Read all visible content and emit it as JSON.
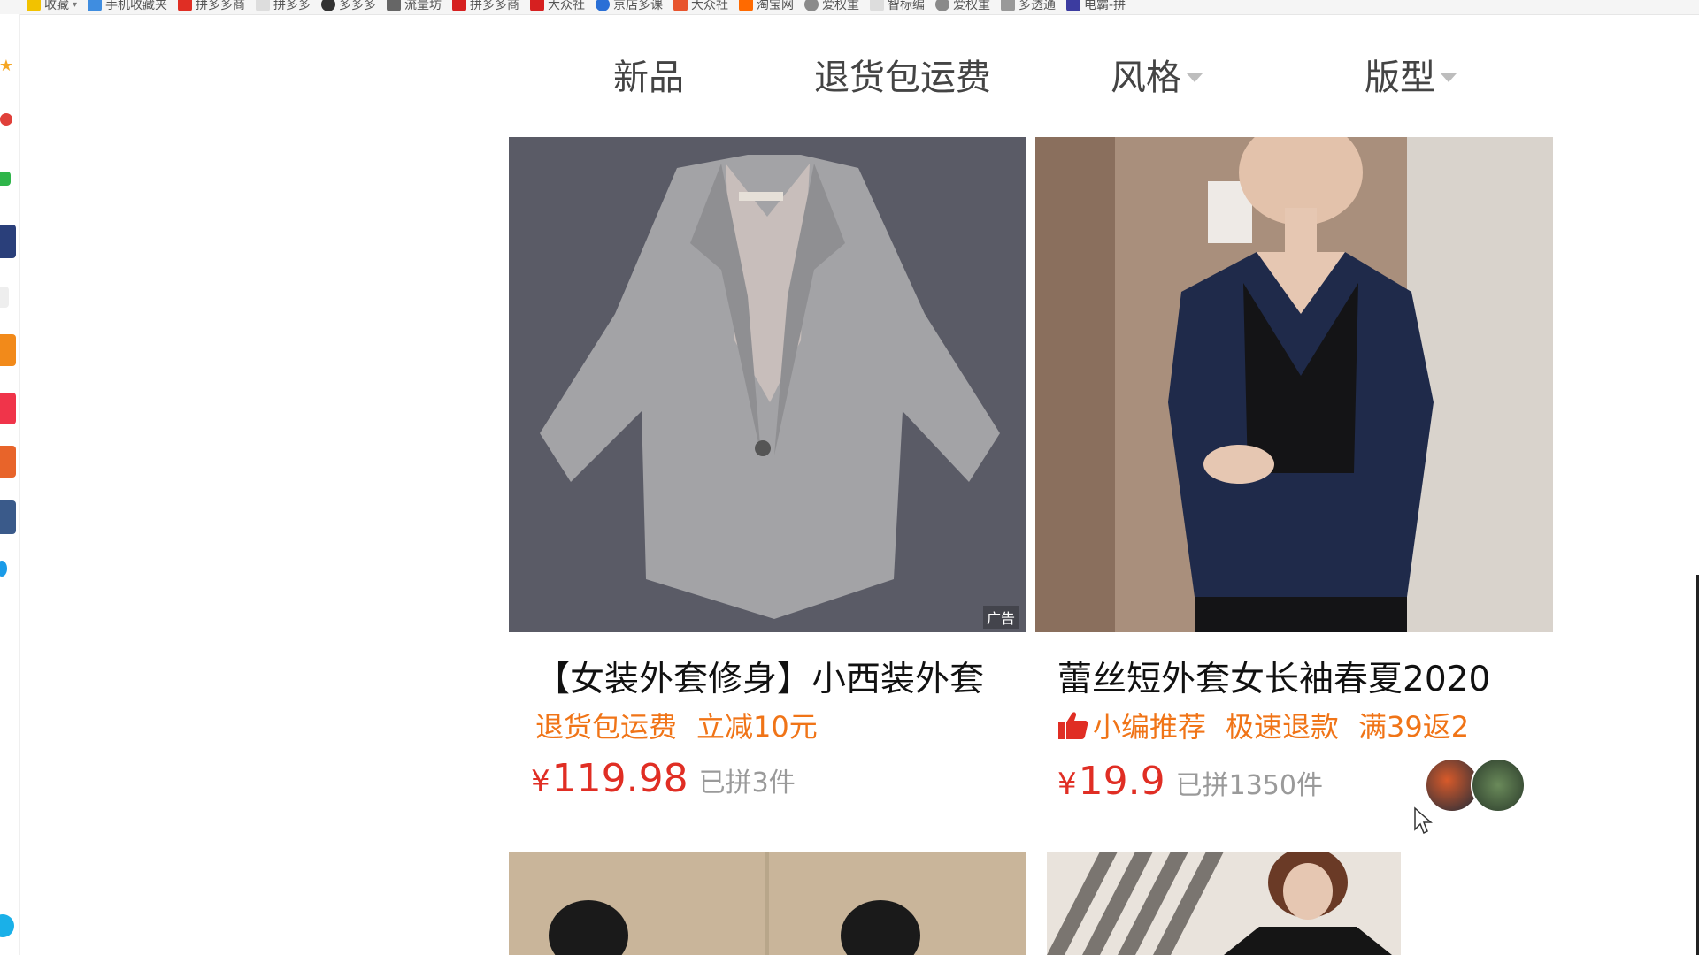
{
  "bookmarks": [
    {
      "label": "收藏",
      "color": "#f2c200",
      "dropdown": true
    },
    {
      "label": "手机收藏夹",
      "color": "#3f8de0"
    },
    {
      "label": "拼多多商",
      "color": "#e02e24"
    },
    {
      "label": "拼多多",
      "color": "#cccccc"
    },
    {
      "label": "多多多",
      "color": "#333333"
    },
    {
      "label": "流量坊",
      "color": "#666666"
    },
    {
      "label": "拼多多商",
      "color": "#d62020"
    },
    {
      "label": "大众社",
      "color": "#d62020"
    },
    {
      "label": "京店多课",
      "color": "#2a6fd6"
    },
    {
      "label": "大众社",
      "color": "#e8542d"
    },
    {
      "label": "淘宝网",
      "color": "#ff6a00"
    },
    {
      "label": "爱权重",
      "color": "#8a8a8a"
    },
    {
      "label": "智标编",
      "color": "#bbbbbb"
    },
    {
      "label": "爱权重",
      "color": "#8a8a8a"
    },
    {
      "label": "多透通",
      "color": "#999999"
    },
    {
      "label": "电霸-拼",
      "color": "#3c3ca0"
    }
  ],
  "filters": [
    {
      "label": "新品",
      "has_caret": false
    },
    {
      "label": "退货包运费",
      "has_caret": false
    },
    {
      "label": "风格",
      "has_caret": true
    },
    {
      "label": "版型",
      "has_caret": true
    }
  ],
  "products": [
    {
      "title": "【女装外套修身】小西装外套",
      "ad_label": "广告",
      "tags": [
        "退货包运费",
        "立减10元"
      ],
      "price_symbol": "¥",
      "price": "119.98",
      "sold": "已拼3件"
    },
    {
      "title": "蕾丝短外套女长袖春夏2020",
      "tags_icon": "thumbs-up-icon",
      "tags": [
        "小编推荐",
        "极速退款",
        "满39返2"
      ],
      "price_symbol": "¥",
      "price": "19.9",
      "sold": "已拼1350件"
    }
  ],
  "colors": {
    "price": "#e02e24",
    "tag": "#f07417",
    "sold": "#9a9a9a"
  }
}
